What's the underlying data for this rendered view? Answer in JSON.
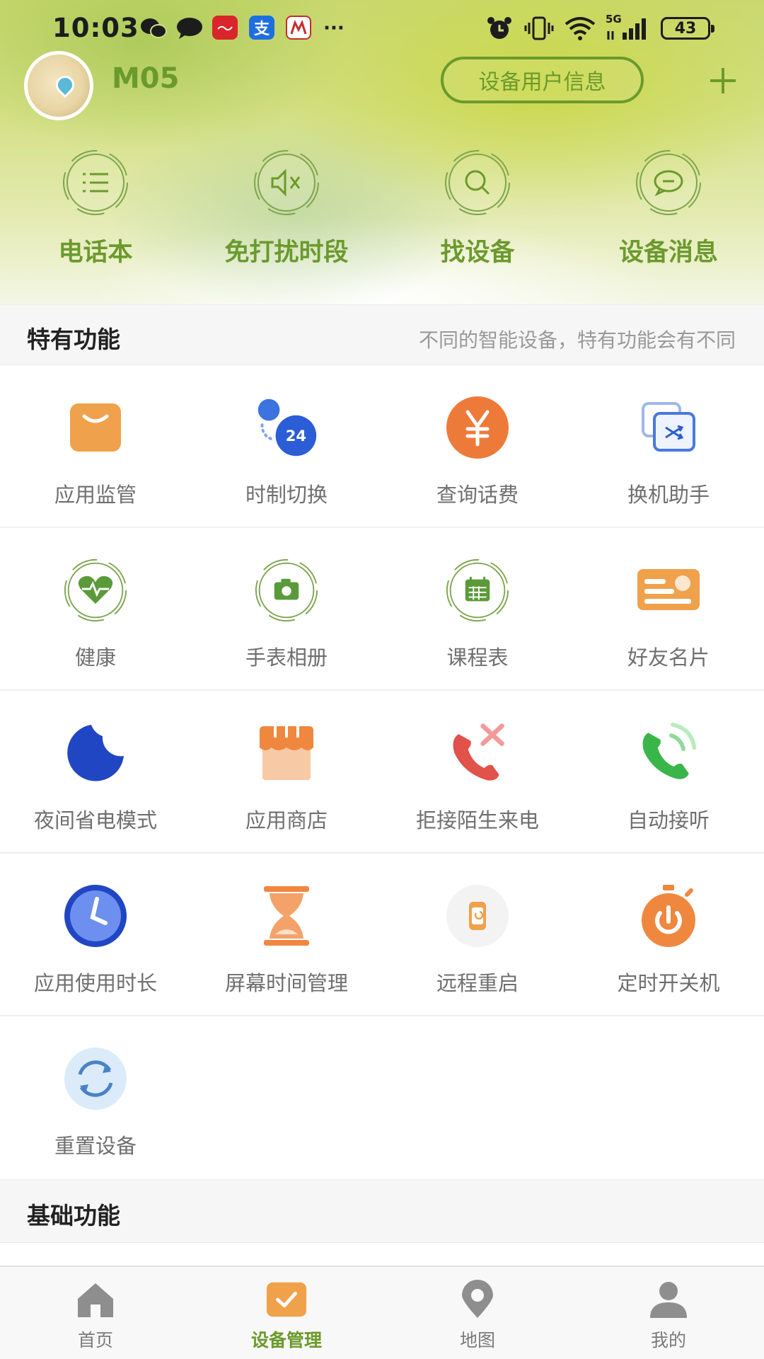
{
  "status_bar": {
    "time": "10:03",
    "battery": "43",
    "network": "5G"
  },
  "header": {
    "device_name": "M05",
    "user_info_button": "设备用户信息",
    "add_icon": "plus-icon",
    "quick_actions": [
      {
        "label": "电话本",
        "icon": "list-icon"
      },
      {
        "label": "免打扰时段",
        "icon": "mute-icon"
      },
      {
        "label": "找设备",
        "icon": "search-icon"
      },
      {
        "label": "设备消息",
        "icon": "chat-icon"
      }
    ]
  },
  "special_section": {
    "title": "特有功能",
    "subtitle": "不同的智能设备，特有功能会有不同",
    "items": [
      {
        "label": "应用监管",
        "icon": "shopping-bag-icon"
      },
      {
        "label": "时制切换",
        "icon": "24h-icon"
      },
      {
        "label": "查询话费",
        "icon": "yen-icon"
      },
      {
        "label": "换机助手",
        "icon": "swap-device-icon"
      },
      {
        "label": "健康",
        "icon": "heart-icon"
      },
      {
        "label": "手表相册",
        "icon": "camera-icon"
      },
      {
        "label": "课程表",
        "icon": "calendar-icon"
      },
      {
        "label": "好友名片",
        "icon": "card-icon"
      },
      {
        "label": "夜间省电模式",
        "icon": "moon-icon"
      },
      {
        "label": "应用商店",
        "icon": "store-icon"
      },
      {
        "label": "拒接陌生来电",
        "icon": "reject-call-icon"
      },
      {
        "label": "自动接听",
        "icon": "auto-answer-icon"
      },
      {
        "label": "应用使用时长",
        "icon": "clock-icon"
      },
      {
        "label": "屏幕时间管理",
        "icon": "hourglass-icon"
      },
      {
        "label": "远程重启",
        "icon": "restart-watch-icon"
      },
      {
        "label": "定时开关机",
        "icon": "power-timer-icon"
      },
      {
        "label": "重置设备",
        "icon": "reset-icon"
      }
    ]
  },
  "basic_section": {
    "title": "基础功能"
  },
  "bottom_nav": [
    {
      "label": "首页",
      "icon": "home-icon",
      "active": false
    },
    {
      "label": "设备管理",
      "icon": "device-manage-icon",
      "active": true
    },
    {
      "label": "地图",
      "icon": "map-pin-icon",
      "active": false
    },
    {
      "label": "我的",
      "icon": "user-icon",
      "active": false
    }
  ],
  "colors": {
    "accent": "#6b9a2c",
    "orange": "#f0a14c",
    "blue": "#3858d6",
    "gray_text": "#6f6f6f"
  }
}
